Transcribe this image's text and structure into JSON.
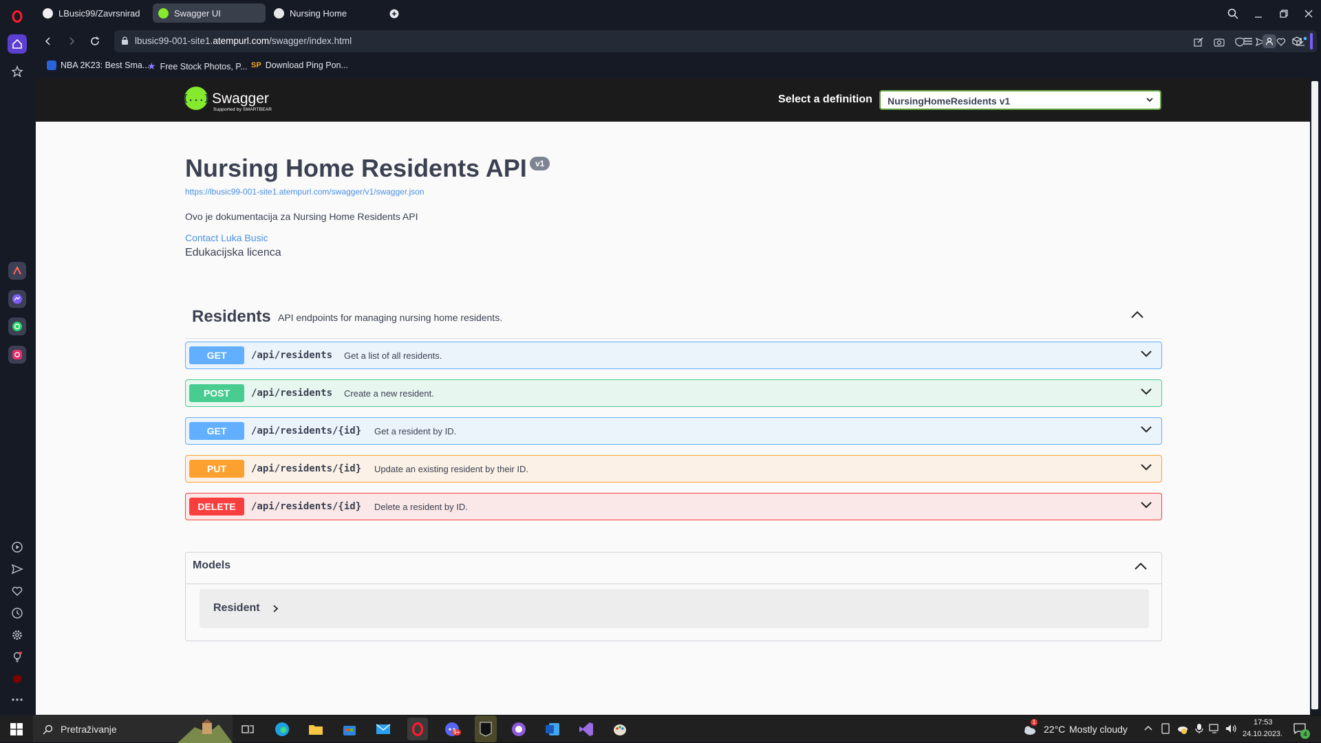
{
  "browser": {
    "tabs": [
      {
        "label": "LBusic99/Zavrsnirad"
      },
      {
        "label": "Swagger UI"
      },
      {
        "label": "Nursing Home"
      }
    ],
    "url_prefix": "lbusic99-001-site1.",
    "url_domain": "atempurl.com",
    "url_path": "/swagger/index.html",
    "bookmarks": [
      {
        "label": "NBA 2K23: Best Sma..."
      },
      {
        "label": "Free Stock Photos, P..."
      },
      {
        "label": "Download Ping Pon..."
      }
    ],
    "bookmark_badge": "SP"
  },
  "swagger": {
    "logo_text": "Swagger",
    "logo_glyph": "{...}",
    "logo_sub": "Supported by SMARTBEAR",
    "select_label": "Select a definition",
    "select_value": "NursingHomeResidents v1",
    "title": "Nursing Home Residents API",
    "version": "v1",
    "spec_url": "https://lbusic99-001-site1.atempurl.com/swagger/v1/swagger.json",
    "description": "Ovo je dokumentacija za Nursing Home Residents API",
    "contact": "Contact Luka Busic",
    "license": "Edukacijska licenca",
    "tag": {
      "name": "Residents",
      "description": "API endpoints for managing nursing home residents."
    },
    "operations": [
      {
        "method": "GET",
        "path": "/api/residents",
        "summary": "Get a list of all residents."
      },
      {
        "method": "POST",
        "path": "/api/residents",
        "summary": "Create a new resident."
      },
      {
        "method": "GET",
        "path": "/api/residents/{id}",
        "summary": "Get a resident by ID."
      },
      {
        "method": "PUT",
        "path": "/api/residents/{id}",
        "summary": "Update an existing resident by their ID."
      },
      {
        "method": "DELETE",
        "path": "/api/residents/{id}",
        "summary": "Delete a resident by ID."
      }
    ],
    "models_title": "Models",
    "models": [
      {
        "name": "Resident"
      }
    ]
  },
  "taskbar": {
    "search_placeholder": "Pretraživanje",
    "weather": "22°C",
    "weather_desc": "Mostly cloudy",
    "weather_badge": "1",
    "time": "17:53",
    "date": "24.10.2023.",
    "notification_count": "4",
    "discord_badge": "9+"
  },
  "colors": {
    "get": "#61affe",
    "post": "#49cc90",
    "put": "#fca130",
    "delete": "#f93e3e",
    "swagger_green": "#85ea2d",
    "link": "#4990e2"
  }
}
